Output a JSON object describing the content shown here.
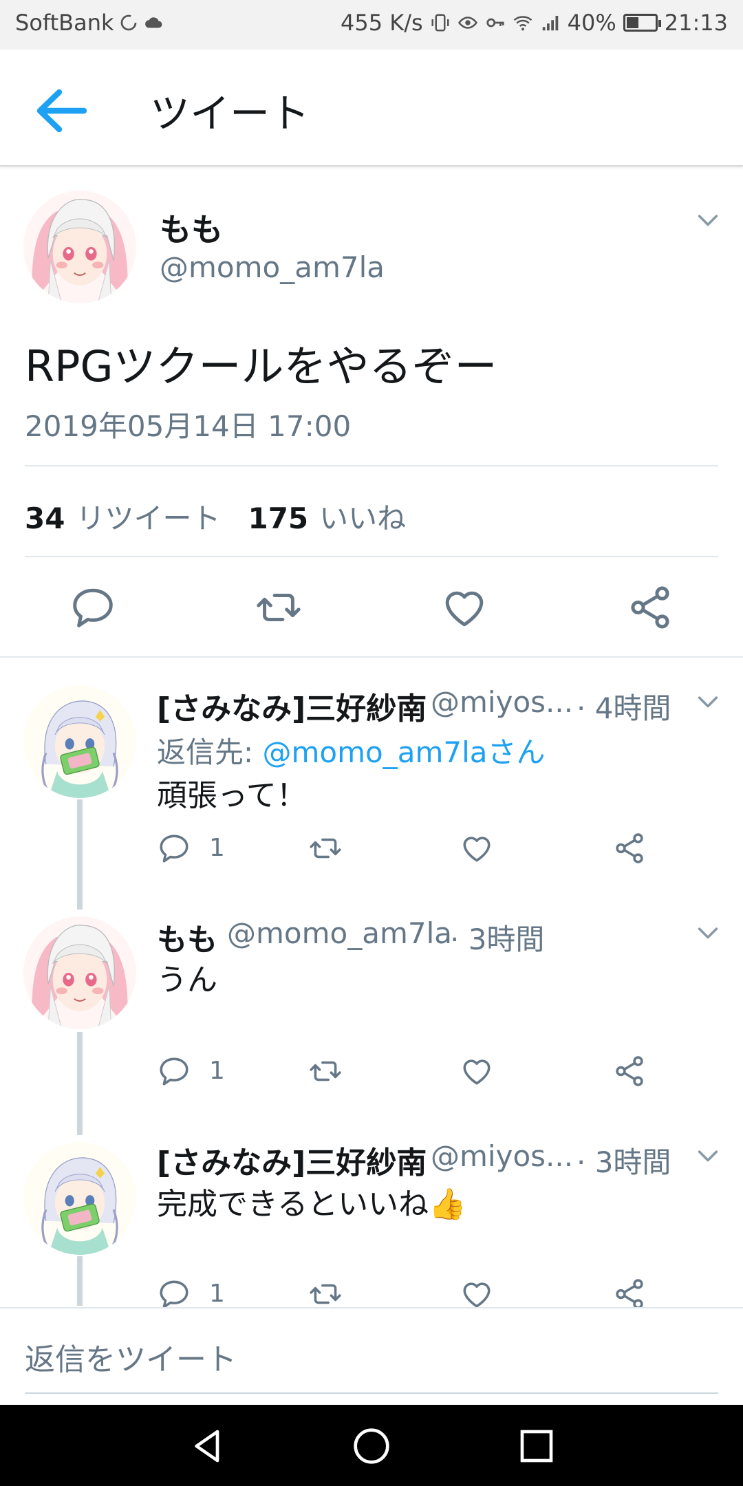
{
  "status_bar": {
    "carrier": "SoftBank",
    "speed": "455 K/s",
    "battery": "40%",
    "battery_level": 0.4,
    "time": "21:13"
  },
  "header": {
    "title": "ツイート"
  },
  "tweet": {
    "name": "もも",
    "handle": "@momo_am7la",
    "text": "RPGツクールをやるぞー",
    "date": "2019年05月14日 17:00",
    "retweet_count": "34",
    "retweet_label": "リツイート",
    "like_count": "175",
    "like_label": "いいね"
  },
  "replies": [
    {
      "name": "[さみなみ]三好紗南",
      "handle": "@miyos...",
      "time": "· 4時間",
      "reply_to_prefix": "返信先: ",
      "reply_to_link": "@momo_am7laさん",
      "text": "頑張って！",
      "reply_count": "1"
    },
    {
      "name": "もも",
      "handle": "@momo_am7la",
      "time": "· 3時間",
      "text": "うん",
      "reply_count": "1"
    },
    {
      "name": "[さみなみ]三好紗南",
      "handle": "@miyos...",
      "time": "· 3時間",
      "text": "完成できるといいね👍",
      "reply_count": "1"
    }
  ],
  "reply_box": {
    "placeholder": "返信をツイート"
  },
  "colors": {
    "accent": "#1da1f2",
    "secondary_text": "#657786",
    "primary_text": "#14171a"
  }
}
